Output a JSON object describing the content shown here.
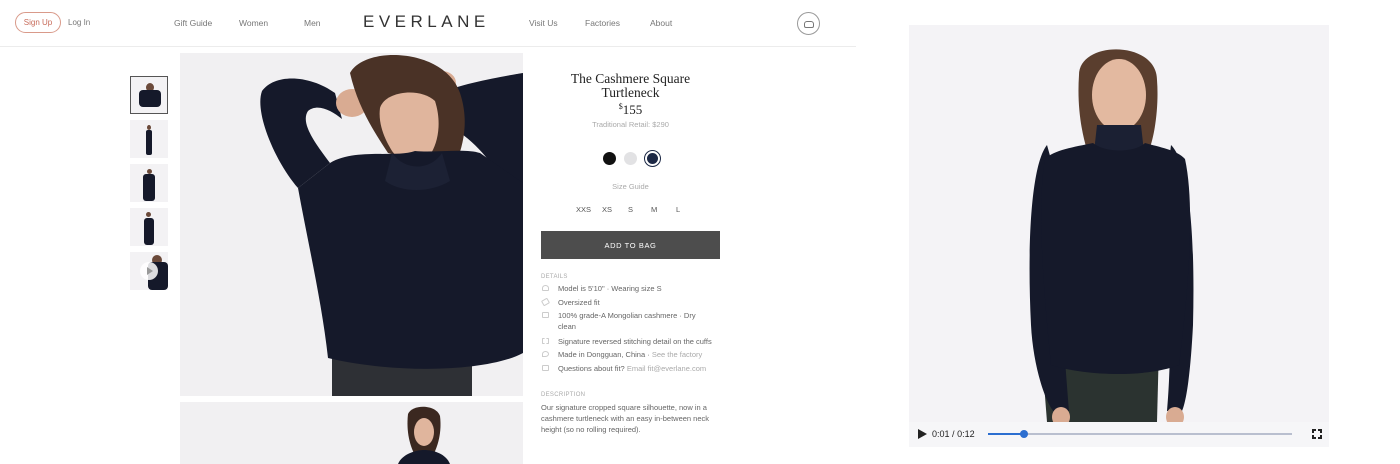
{
  "header": {
    "signup_label": "Sign Up",
    "login_label": "Log In",
    "nav_left": [
      "Gift Guide",
      "Women",
      "Men"
    ],
    "logo": "EVERLANE",
    "nav_right": [
      "Visit Us",
      "Factories",
      "About"
    ]
  },
  "product": {
    "title_line1": "The Cashmere Square",
    "title_line2": "Turtleneck",
    "price_symbol": "$",
    "price": "155",
    "retail": "Traditional Retail: $290",
    "colors": [
      "#111111",
      "#e2e2e4",
      "#1c2845"
    ],
    "selected_color_index": 2,
    "size_guide": "Size Guide",
    "sizes": [
      "XXS",
      "XS",
      "S",
      "M",
      "L"
    ],
    "add_to_bag": "ADD TO BAG",
    "details_label": "DETAILS",
    "details": {
      "model": "Model is 5'10\"",
      "wearing": "Wearing size S",
      "fit": "Oversized fit",
      "material": "100% grade-A Mongolian cashmere",
      "care_1": "Dry",
      "care_2": "clean",
      "stitch": "Signature reversed stitching detail on the cuffs",
      "made_in": "Made in Dongguan, China",
      "factory_link": "See the factory",
      "questions": "Questions about fit?",
      "email_link": "Email fit@everlane.com"
    },
    "description_label": "DESCRIPTION",
    "description": "Our signature cropped square silhouette, now in a cashmere turtleneck with an easy in-between neck height (so no rolling required)."
  },
  "video": {
    "current": "0:01",
    "separator": "/",
    "duration": "0:12",
    "progress": 0.12
  },
  "colors": {
    "accent": "#2c6ed0",
    "sweater": "#15192a",
    "signup_border": "#d99a8a"
  }
}
